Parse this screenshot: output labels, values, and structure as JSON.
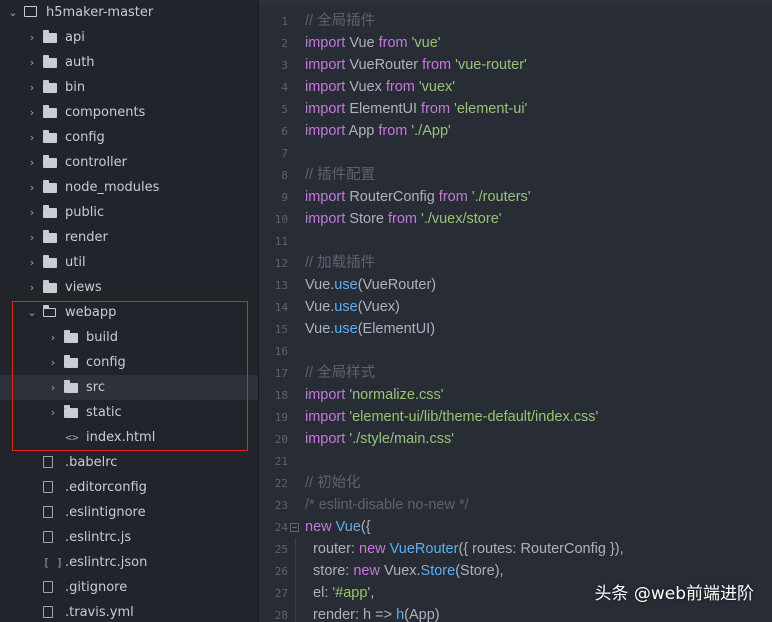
{
  "sidebar": {
    "root": "h5maker-master",
    "items": [
      {
        "label": "api",
        "type": "folder"
      },
      {
        "label": "auth",
        "type": "folder"
      },
      {
        "label": "bin",
        "type": "folder"
      },
      {
        "label": "components",
        "type": "folder"
      },
      {
        "label": "config",
        "type": "folder"
      },
      {
        "label": "controller",
        "type": "folder"
      },
      {
        "label": "node_modules",
        "type": "folder"
      },
      {
        "label": "public",
        "type": "folder"
      },
      {
        "label": "render",
        "type": "folder"
      },
      {
        "label": "util",
        "type": "folder"
      },
      {
        "label": "views",
        "type": "folder"
      },
      {
        "label": "webapp",
        "type": "folder-open"
      },
      {
        "label": "build",
        "type": "folder"
      },
      {
        "label": "config",
        "type": "folder"
      },
      {
        "label": "src",
        "type": "folder",
        "selected": true
      },
      {
        "label": "static",
        "type": "folder"
      },
      {
        "label": "index.html",
        "type": "html"
      },
      {
        "label": ".babelrc",
        "type": "file"
      },
      {
        "label": ".editorconfig",
        "type": "file"
      },
      {
        "label": ".eslintignore",
        "type": "file"
      },
      {
        "label": ".eslintrc.js",
        "type": "js"
      },
      {
        "label": ".eslintrc.json",
        "type": "json"
      },
      {
        "label": ".gitignore",
        "type": "file"
      },
      {
        "label": ".travis.yml",
        "type": "file"
      }
    ]
  },
  "editor": {
    "lines": [
      {
        "n": "1",
        "tokens": [
          [
            "cm",
            "// 全局插件"
          ]
        ]
      },
      {
        "n": "2",
        "tokens": [
          [
            "kw",
            "import"
          ],
          [
            "def",
            " Vue "
          ],
          [
            "kw",
            "from"
          ],
          [
            "str",
            " 'vue'"
          ]
        ]
      },
      {
        "n": "3",
        "tokens": [
          [
            "kw",
            "import"
          ],
          [
            "def",
            " VueRouter "
          ],
          [
            "kw",
            "from"
          ],
          [
            "str",
            " 'vue-router'"
          ]
        ]
      },
      {
        "n": "4",
        "tokens": [
          [
            "kw",
            "import"
          ],
          [
            "def",
            " Vuex "
          ],
          [
            "kw",
            "from"
          ],
          [
            "str",
            " 'vuex'"
          ]
        ]
      },
      {
        "n": "5",
        "tokens": [
          [
            "kw",
            "import"
          ],
          [
            "def",
            " ElementUI "
          ],
          [
            "kw",
            "from"
          ],
          [
            "str",
            " 'element-ui'"
          ]
        ]
      },
      {
        "n": "6",
        "tokens": [
          [
            "kw",
            "import"
          ],
          [
            "def",
            " App "
          ],
          [
            "kw",
            "from"
          ],
          [
            "str",
            " './App'"
          ]
        ]
      },
      {
        "n": "7",
        "tokens": []
      },
      {
        "n": "8",
        "tokens": [
          [
            "cm",
            "// 插件配置"
          ]
        ]
      },
      {
        "n": "9",
        "tokens": [
          [
            "kw",
            "import"
          ],
          [
            "def",
            " RouterConfig "
          ],
          [
            "kw",
            "from"
          ],
          [
            "str",
            " './routers'"
          ]
        ]
      },
      {
        "n": "10",
        "tokens": [
          [
            "kw",
            "import"
          ],
          [
            "def",
            " Store "
          ],
          [
            "kw",
            "from"
          ],
          [
            "str",
            " './vuex/store'"
          ]
        ]
      },
      {
        "n": "11",
        "tokens": []
      },
      {
        "n": "12",
        "tokens": [
          [
            "cm",
            "// 加载插件"
          ]
        ]
      },
      {
        "n": "13",
        "tokens": [
          [
            "def",
            "Vue."
          ],
          [
            "fn",
            "use"
          ],
          [
            "def",
            "(VueRouter)"
          ]
        ]
      },
      {
        "n": "14",
        "tokens": [
          [
            "def",
            "Vue."
          ],
          [
            "fn",
            "use"
          ],
          [
            "def",
            "(Vuex)"
          ]
        ]
      },
      {
        "n": "15",
        "tokens": [
          [
            "def",
            "Vue."
          ],
          [
            "fn",
            "use"
          ],
          [
            "def",
            "(ElementUI)"
          ]
        ]
      },
      {
        "n": "16",
        "tokens": []
      },
      {
        "n": "17",
        "tokens": [
          [
            "cm",
            "// 全局样式"
          ]
        ]
      },
      {
        "n": "18",
        "tokens": [
          [
            "kw",
            "import"
          ],
          [
            "str",
            " 'normalize.css'"
          ]
        ]
      },
      {
        "n": "19",
        "tokens": [
          [
            "kw",
            "import"
          ],
          [
            "str",
            " 'element-ui/lib/theme-default/index.css'"
          ]
        ]
      },
      {
        "n": "20",
        "tokens": [
          [
            "kw",
            "import"
          ],
          [
            "str",
            " './style/main.css'"
          ]
        ]
      },
      {
        "n": "21",
        "tokens": []
      },
      {
        "n": "22",
        "tokens": [
          [
            "cm",
            "// 初始化"
          ]
        ]
      },
      {
        "n": "23",
        "tokens": [
          [
            "cm",
            "/* eslint-disable no-new */"
          ]
        ]
      },
      {
        "n": "24",
        "tokens": [
          [
            "kw",
            "new"
          ],
          [
            "def",
            " "
          ],
          [
            "fn",
            "Vue"
          ],
          [
            "def",
            "({"
          ]
        ],
        "fold": "−"
      },
      {
        "n": "25",
        "tokens": [
          [
            "def",
            "  router: "
          ],
          [
            "kw",
            "new"
          ],
          [
            "def",
            " "
          ],
          [
            "fn",
            "VueRouter"
          ],
          [
            "def",
            "({ routes: RouterConfig }),"
          ]
        ]
      },
      {
        "n": "26",
        "tokens": [
          [
            "def",
            "  store: "
          ],
          [
            "kw",
            "new"
          ],
          [
            "def",
            " Vuex."
          ],
          [
            "fn",
            "Store"
          ],
          [
            "def",
            "(Store),"
          ]
        ]
      },
      {
        "n": "27",
        "tokens": [
          [
            "def",
            "  el: "
          ],
          [
            "str",
            "'#app'"
          ],
          [
            "def",
            ","
          ]
        ]
      },
      {
        "n": "28",
        "tokens": [
          [
            "def",
            "  render: h => "
          ],
          [
            "fn",
            "h"
          ],
          [
            "def",
            "(App)"
          ]
        ]
      }
    ]
  },
  "watermark": "头条 @web前端进阶"
}
